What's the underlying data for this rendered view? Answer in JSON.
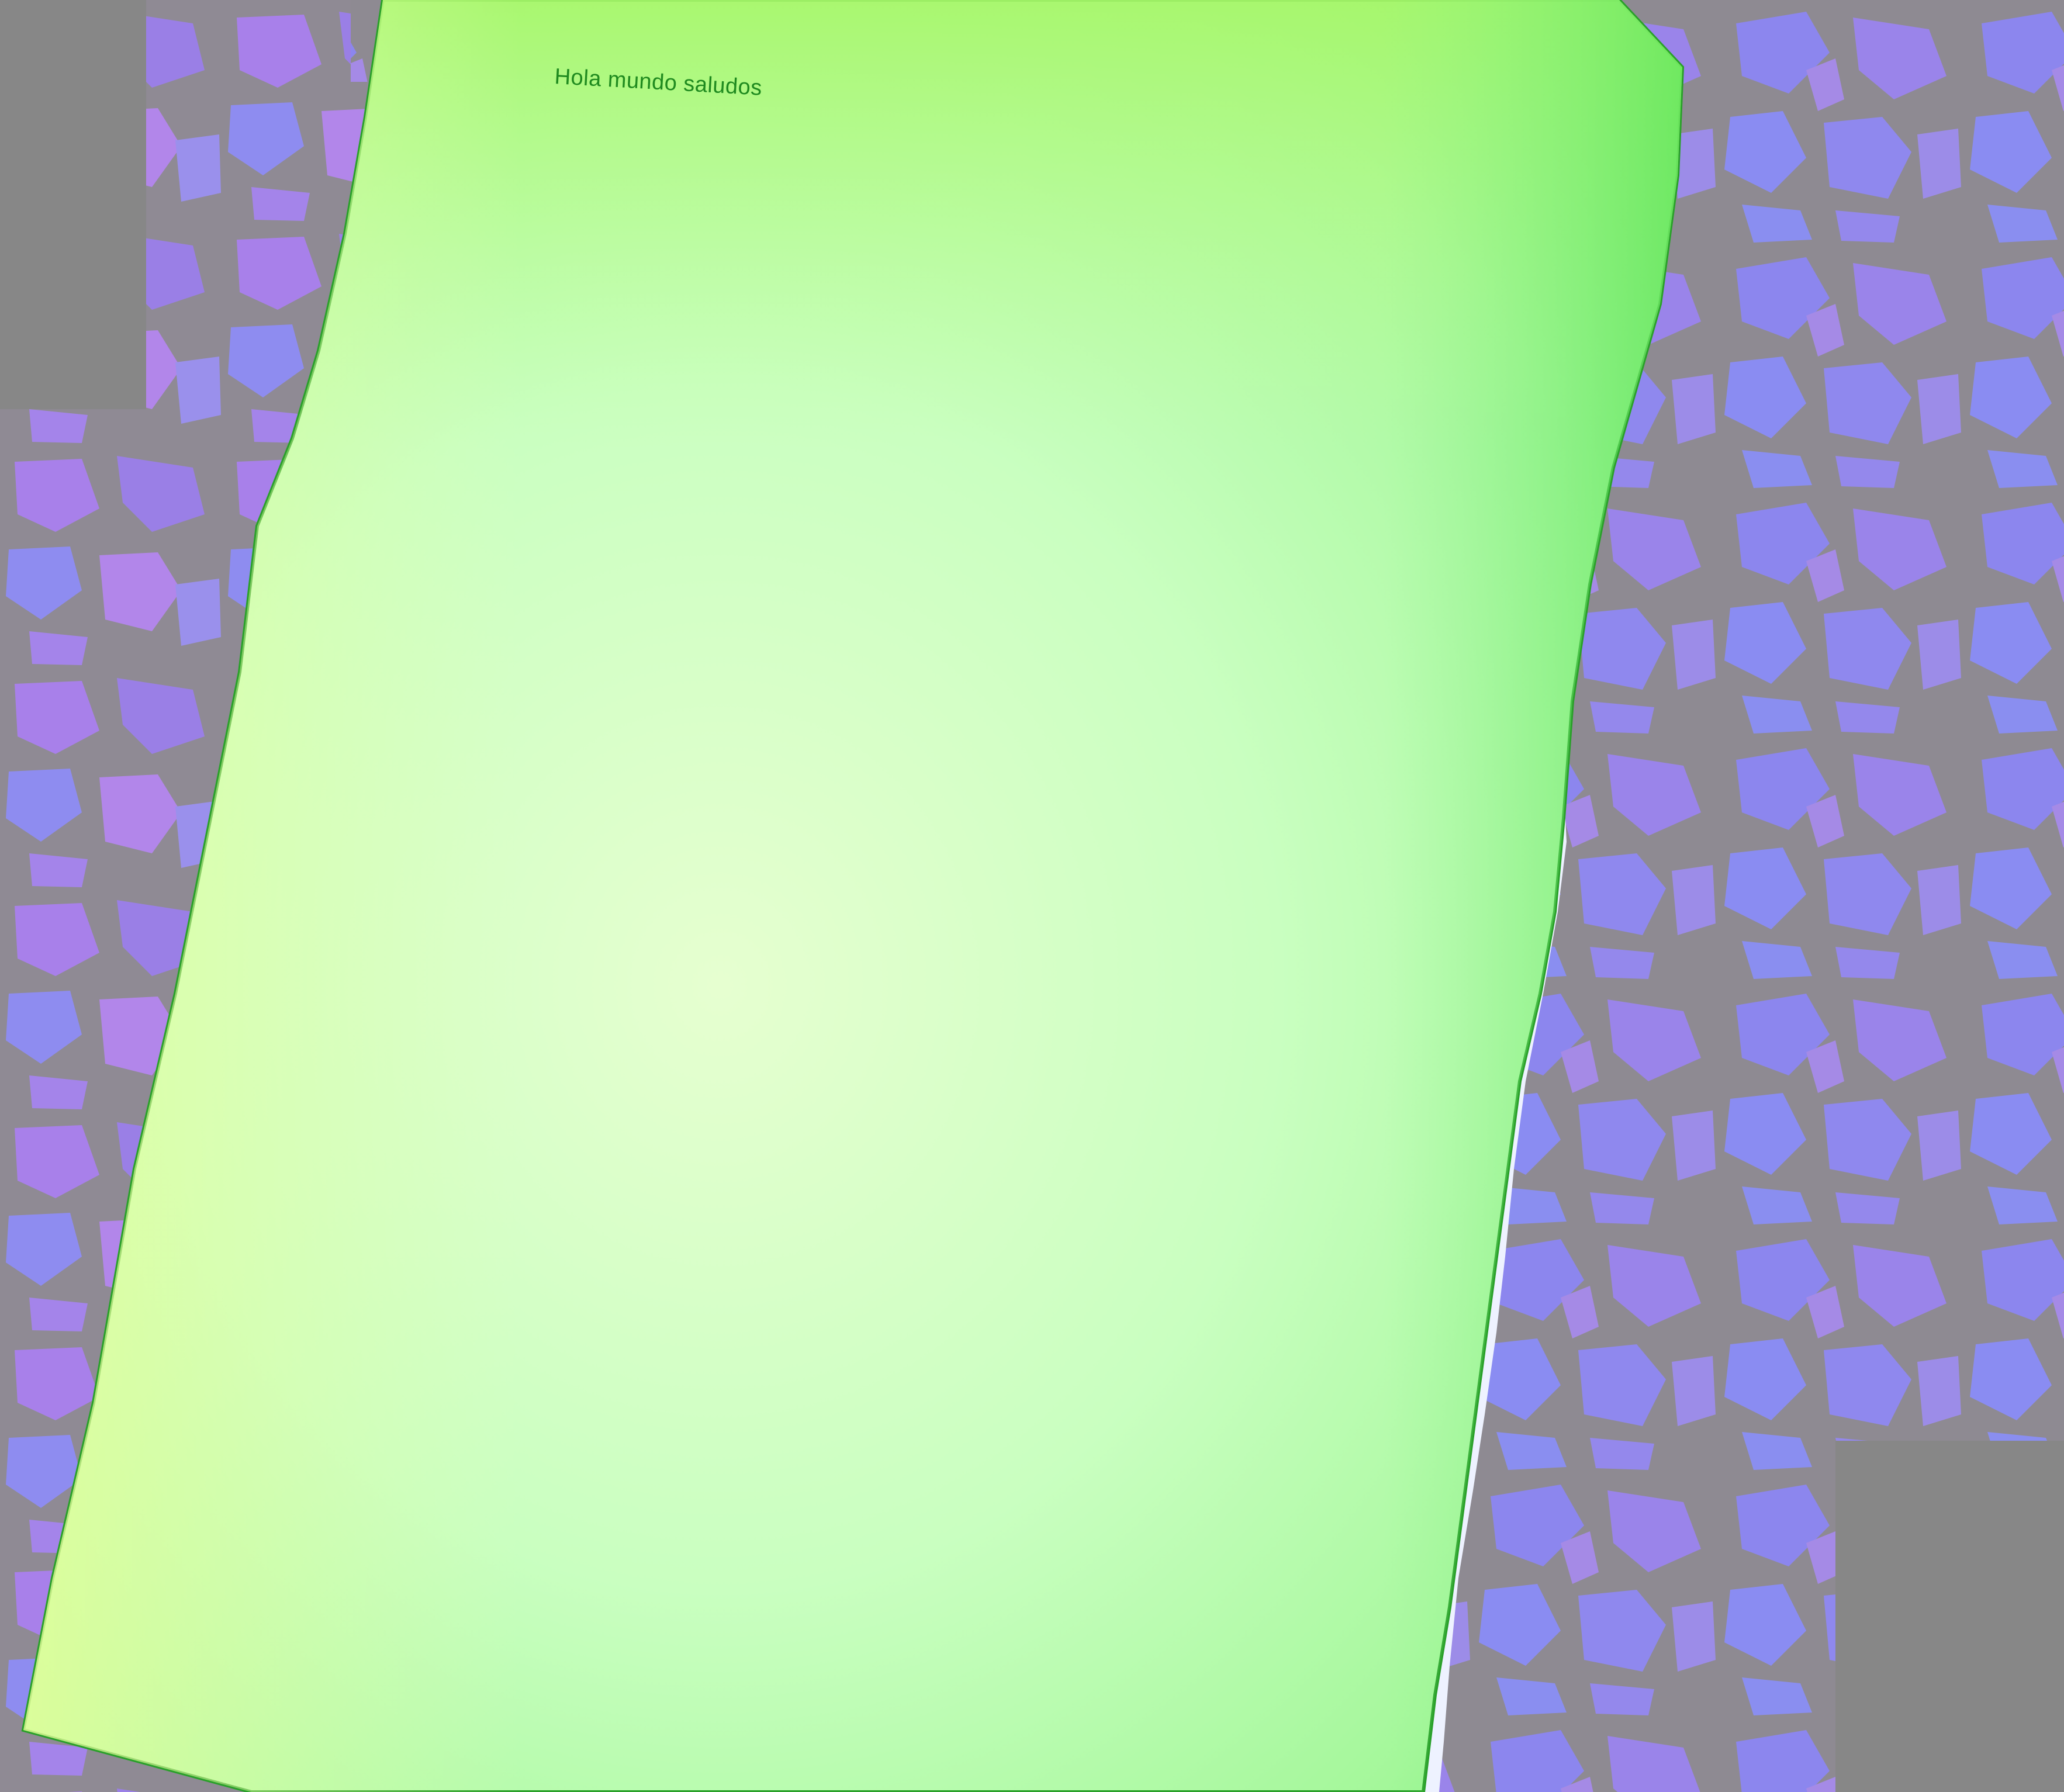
{
  "document": {
    "text": "Hola mundo saludos"
  },
  "colors": {
    "paper_light": "#e4ffc4",
    "paper_edge": "#7ef07a",
    "paper_top": "#a8f56a",
    "text": "#1f8a1f",
    "tile_fill": "#8c8cf0",
    "tile_fill_violet": "#a97ee8",
    "grout": "#8e8a92",
    "mask_gray": "#878787",
    "torn_edge": "#eef2ff"
  }
}
